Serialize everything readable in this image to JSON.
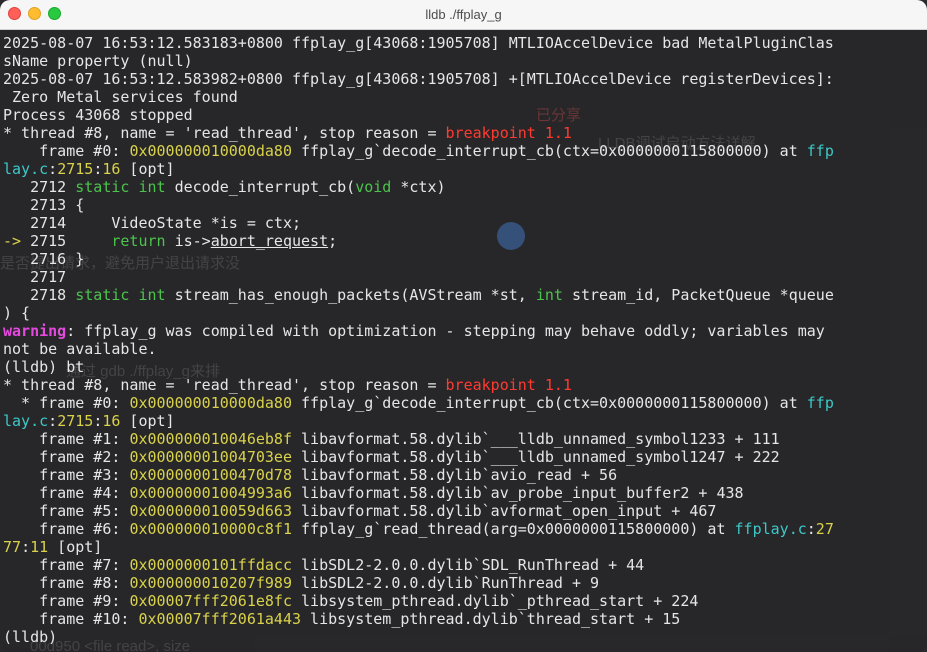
{
  "window": {
    "title": "lldb ./ffplay_g"
  },
  "background_ghost": {
    "text1": "LLDB调试启动方法详解",
    "text2": "是否提出请求，避免用户退出请求没",
    "text3": "通过 gdb ./ffplay_g来排",
    "text4": "00d950 <file read>, size",
    "badge": "已分享"
  },
  "terminal": {
    "lines": [
      [
        {
          "t": "2025-08-07 16:53:12.583183+0800 ffplay_g[43068:1905708] MTLIOAccelDevice bad MetalPluginClas"
        }
      ],
      [
        {
          "t": "sName property (null)"
        }
      ],
      [
        {
          "t": "2025-08-07 16:53:12.583982+0800 ffplay_g[43068:1905708] +[MTLIOAccelDevice registerDevices]:"
        }
      ],
      [
        {
          "t": " Zero Metal services found"
        }
      ],
      [
        {
          "t": "Process 43068 stopped"
        }
      ],
      [
        {
          "t": "* thread #8, name = 'read_thread', stop reason = "
        },
        {
          "t": "breakpoint 1.1",
          "s": "r"
        }
      ],
      [
        {
          "t": "    frame #0: "
        },
        {
          "t": "0x000000010000da80",
          "s": "y"
        },
        {
          "t": " ffplay_g`decode_interrupt_cb(ctx=0x0000000115800000) at "
        },
        {
          "t": "ffp",
          "s": "c"
        }
      ],
      [
        {
          "t": "lay.c",
          "s": "c"
        },
        {
          "t": ":"
        },
        {
          "t": "2715",
          "s": "y"
        },
        {
          "t": ":"
        },
        {
          "t": "16",
          "s": "y"
        },
        {
          "t": " [opt]"
        }
      ],
      [
        {
          "t": "   2712 "
        },
        {
          "t": "static int",
          "s": "g"
        },
        {
          "t": " decode_interrupt_cb("
        },
        {
          "t": "void",
          "s": "g"
        },
        {
          "t": " *ctx)"
        }
      ],
      [
        {
          "t": "   2713 {"
        }
      ],
      [
        {
          "t": "   2714     VideoState *is = ctx;"
        }
      ],
      [
        {
          "t": "-> ",
          "s": "y"
        },
        {
          "t": "2715     "
        },
        {
          "t": "return",
          "s": "g"
        },
        {
          "t": " is->"
        },
        {
          "t": "abort_request",
          "s": "u"
        },
        {
          "t": ";"
        }
      ],
      [
        {
          "t": "   2716 }"
        }
      ],
      [
        {
          "t": "   2717"
        }
      ],
      [
        {
          "t": "   2718 "
        },
        {
          "t": "static int",
          "s": "g"
        },
        {
          "t": " stream_has_enough_packets(AVStream *st, "
        },
        {
          "t": "int",
          "s": "g"
        },
        {
          "t": " stream_id, PacketQueue *queue"
        }
      ],
      [
        {
          "t": ") {"
        }
      ],
      [
        {
          "t": "warning",
          "s": "m"
        },
        {
          "t": ": ffplay_g was compiled with optimization - stepping may behave oddly; variables may"
        }
      ],
      [
        {
          "t": "not be available."
        }
      ],
      [
        {
          "t": "(lldb) bt"
        }
      ],
      [
        {
          "t": "* thread #8, name = 'read_thread', stop reason = "
        },
        {
          "t": "breakpoint 1.1",
          "s": "r"
        }
      ],
      [
        {
          "t": "  * frame #0: "
        },
        {
          "t": "0x000000010000da80",
          "s": "y"
        },
        {
          "t": " ffplay_g`decode_interrupt_cb(ctx=0x0000000115800000) at "
        },
        {
          "t": "ffp",
          "s": "c"
        }
      ],
      [
        {
          "t": "lay.c",
          "s": "c"
        },
        {
          "t": ":"
        },
        {
          "t": "2715",
          "s": "y"
        },
        {
          "t": ":"
        },
        {
          "t": "16",
          "s": "y"
        },
        {
          "t": " [opt]"
        }
      ],
      [
        {
          "t": "    frame #1: "
        },
        {
          "t": "0x000000010046eb8f",
          "s": "y"
        },
        {
          "t": " libavformat.58.dylib`___lldb_unnamed_symbol1233 + 111"
        }
      ],
      [
        {
          "t": "    frame #2: "
        },
        {
          "t": "0x00000001004703ee",
          "s": "y"
        },
        {
          "t": " libavformat.58.dylib`___lldb_unnamed_symbol1247 + 222"
        }
      ],
      [
        {
          "t": "    frame #3: "
        },
        {
          "t": "0x0000000100470d78",
          "s": "y"
        },
        {
          "t": " libavformat.58.dylib`avio_read + 56"
        }
      ],
      [
        {
          "t": "    frame #4: "
        },
        {
          "t": "0x00000001004993a6",
          "s": "y"
        },
        {
          "t": " libavformat.58.dylib`av_probe_input_buffer2 + 438"
        }
      ],
      [
        {
          "t": "    frame #5: "
        },
        {
          "t": "0x000000010059d663",
          "s": "y"
        },
        {
          "t": " libavformat.58.dylib`avformat_open_input + 467"
        }
      ],
      [
        {
          "t": "    frame #6: "
        },
        {
          "t": "0x000000010000c8f1",
          "s": "y"
        },
        {
          "t": " ffplay_g`read_thread(arg=0x0000000115800000) at "
        },
        {
          "t": "ffplay.c",
          "s": "c"
        },
        {
          "t": ":"
        },
        {
          "t": "27",
          "s": "y"
        }
      ],
      [
        {
          "t": "77",
          "s": "y"
        },
        {
          "t": ":"
        },
        {
          "t": "11",
          "s": "y"
        },
        {
          "t": " [opt]"
        }
      ],
      [
        {
          "t": "    frame #7: "
        },
        {
          "t": "0x0000000101ffdacc",
          "s": "y"
        },
        {
          "t": " libSDL2-2.0.0.dylib`SDL_RunThread + 44"
        }
      ],
      [
        {
          "t": "    frame #8: "
        },
        {
          "t": "0x000000010207f989",
          "s": "y"
        },
        {
          "t": " libSDL2-2.0.0.dylib`RunThread + 9"
        }
      ],
      [
        {
          "t": "    frame #9: "
        },
        {
          "t": "0x00007fff2061e8fc",
          "s": "y"
        },
        {
          "t": " libsystem_pthread.dylib`_pthread_start + 224"
        }
      ],
      [
        {
          "t": "    frame #10: "
        },
        {
          "t": "0x00007fff2061a443",
          "s": "y"
        },
        {
          "t": " libsystem_pthread.dylib`thread_start + 15"
        }
      ],
      [
        {
          "t": "(lldb)"
        }
      ]
    ]
  }
}
